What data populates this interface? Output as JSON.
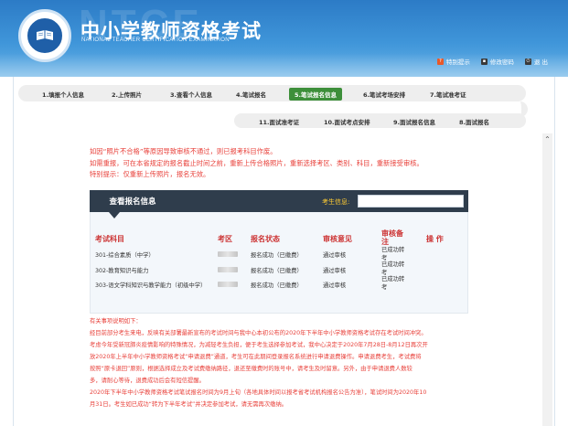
{
  "header": {
    "watermark": "NTCE",
    "title": "中小学教师资格考试",
    "subtitle": "NATIONAL TEACHER CERTIFICATION EXAMINATION",
    "links": [
      {
        "label": "特别提示",
        "icon": "help-icon",
        "color": "#e8592a"
      },
      {
        "label": "修改密码",
        "icon": "key-icon",
        "color": "#3a3a3a"
      },
      {
        "label": "退 出",
        "icon": "power-icon",
        "color": "#3a3a3a"
      }
    ]
  },
  "steps": {
    "row1": [
      "1.填报个人信息",
      "2.上传照片",
      "3.查看个人信息",
      "4.笔试报名",
      "5.笔试报名信息",
      "6.笔试考场安排",
      "7.笔试准考证"
    ],
    "row2": [
      "11.面试准考证",
      "10.面试考点安排",
      "9.面试报名信息",
      "8.面试报名"
    ],
    "active_color": "#3d8f3a"
  },
  "notice": {
    "line1": "如因“照片不合格”等原因导致审核不通过，则已报考科目作废。",
    "line2": "如需重报，可在本省规定的报名截止时间之前，重新上传合格照片，重新选择考区、类别、科目，重新接受审核。",
    "line3": "特别提示：仅重新上传照片，报名无效。"
  },
  "registration": {
    "tab_label": "查看报名信息",
    "examinee_label": "考生信息:",
    "examinee_value": "",
    "columns": [
      "考试科目",
      "考区",
      "报名状态",
      "审核意见",
      "审核备注",
      "操 作"
    ],
    "rows": [
      {
        "subject": "301-综合素质（中学）",
        "status": "报名成功（已缴费）",
        "review": "通过审核",
        "remark": "已成功转考"
      },
      {
        "subject": "302-教育知识与能力",
        "status": "报名成功（已缴费）",
        "review": "通过审核",
        "remark": "已成功转考"
      },
      {
        "subject": "303-语文学科知识与教学能力（初级中学）",
        "status": "报名成功（已缴费）",
        "review": "通过审核",
        "remark": "已成功转考"
      }
    ]
  },
  "notes": {
    "heading": "有关事项说明如下：",
    "lines": [
      "经目前部分考生来电，反映有关部署最新宣布的考试时间与我中心本初公布的2020年下半年中小学教师资格考试存在考试时间冲突。",
      "考虑今年受新冠肺炎疫情影响的特殊情况，为减轻考生负担，便于考生选择参加考试，我中心决定于2020年7月28日-8月12日再次开",
      "放2020年上半年中小学教师资格考试“申请退费”通道，考生可在此期间登录报名系统进行申请退费操作。申请退费考生，考试费将",
      "按照“原卡退回”原则，根据选择成立及考试费缴纳路径，退还至缴费时的账号中，请考生及时留意。另外，由于申请退费人数较",
      "多，请耐心等待，退费成功后会有短信提醒。",
      "2020年下半年中小学教师资格考试笔试报名时间为9月上旬（各地具体时间以报考省考试机构报名公告为准），笔试时间为2020年10",
      "月31日。考生如已成功“转为下半年考试”并决定参加考试，请无需再次缴纳。"
    ]
  }
}
